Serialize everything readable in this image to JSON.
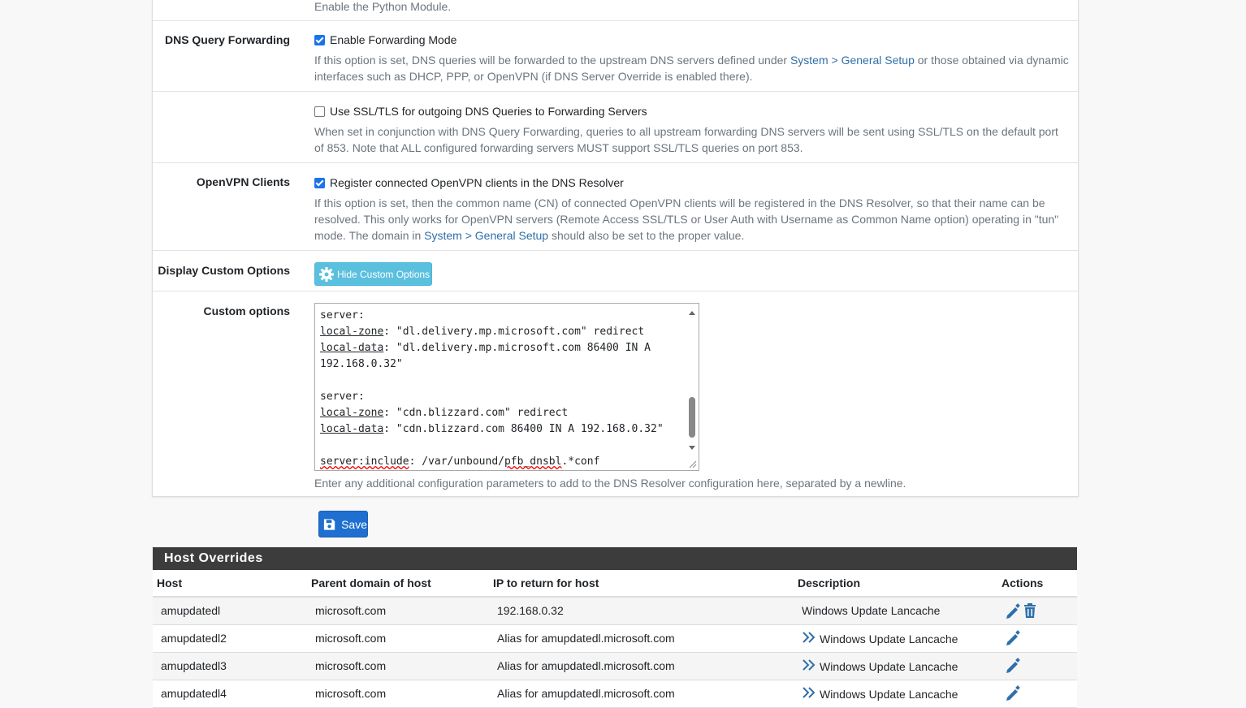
{
  "python_help": "Enable the Python Module.",
  "forwarding": {
    "label": "DNS Query Forwarding",
    "checkbox_label": "Enable Forwarding Mode",
    "checked": true,
    "help_pre": "If this option is set, DNS queries will be forwarded to the upstream DNS servers defined under ",
    "help_link": "System > General Setup",
    "help_post": " or those obtained via dynamic interfaces such as DHCP, PPP, or OpenVPN (if DNS Server Override is enabled there)."
  },
  "ssl": {
    "checkbox_label": "Use SSL/TLS for outgoing DNS Queries to Forwarding Servers",
    "checked": false,
    "help": "When set in conjunction with DNS Query Forwarding, queries to all upstream forwarding DNS servers will be sent using SSL/TLS on the default port of 853. Note that ALL configured forwarding servers MUST support SSL/TLS queries on port 853."
  },
  "openvpn": {
    "label": "OpenVPN Clients",
    "checkbox_label": "Register connected OpenVPN clients in the DNS Resolver",
    "checked": true,
    "help_pre": "If this option is set, then the common name (CN) of connected OpenVPN clients will be registered in the DNS Resolver, so that their name can be resolved. This only works for OpenVPN servers (Remote Access SSL/TLS or User Auth with Username as Common Name option) operating in \"tun\" mode. The domain in ",
    "help_link": "System > General Setup",
    "help_post": " should also be set to the proper value."
  },
  "custom_display": {
    "label": "Display Custom Options",
    "button_label": "Hide Custom Options"
  },
  "custom_options": {
    "label": "Custom options",
    "lines": {
      "l1": "server:",
      "l2a": "local-zone",
      "l2b": ": \"dl.delivery.mp.microsoft.com\" redirect",
      "l3a": "local-data",
      "l3b": ": \"dl.delivery.mp.microsoft.com 86400 IN A",
      "l4": "192.168.0.32\"",
      "l6": "server:",
      "l7a": "local-zone",
      "l7b": ": \"cdn.blizzard.com\" redirect",
      "l8a": "local-data",
      "l8b": ": \"cdn.blizzard.com 86400 IN A 192.168.0.32\"",
      "l10a": "server:include",
      "l10b": ": /var/unbound/",
      "l10c": "pfb_dnsbl",
      "l10d": ".*conf"
    },
    "help": "Enter any additional configuration parameters to add to the DNS Resolver configuration here, separated by a newline."
  },
  "save_label": "Save",
  "host_overrides": {
    "title": "Host Overrides",
    "columns": [
      "Host",
      "Parent domain of host",
      "IP to return for host",
      "Description",
      "Actions"
    ],
    "rows": [
      {
        "host": "amupdatedl",
        "domain": "microsoft.com",
        "ip": "192.168.0.32",
        "description": "Windows Update Lancache"
      },
      {
        "host": "amupdatedl2",
        "domain": "microsoft.com",
        "ip": "Alias for amupdatedl.microsoft.com",
        "description": "Windows Update Lancache"
      },
      {
        "host": "amupdatedl3",
        "domain": "microsoft.com",
        "ip": "Alias for amupdatedl.microsoft.com",
        "description": "Windows Update Lancache"
      },
      {
        "host": "amupdatedl4",
        "domain": "microsoft.com",
        "ip": "Alias for amupdatedl.microsoft.com",
        "description": "Windows Update Lancache"
      }
    ]
  },
  "colors": {
    "link": "#2f6fa8",
    "primary": "#1e6fd0",
    "info": "#5bc0de",
    "header": "#3c3c3c"
  }
}
